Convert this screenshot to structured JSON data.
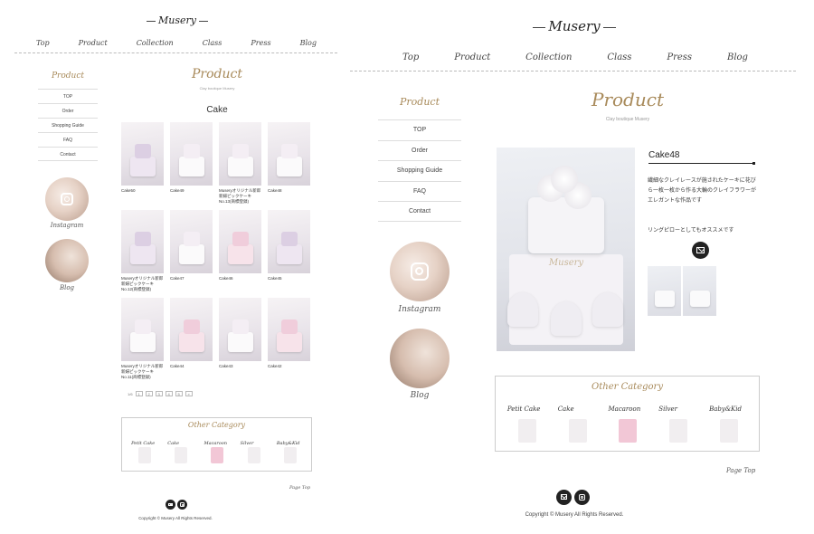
{
  "brand": {
    "logo": "Musery",
    "subtitle": "Clay boutique Musery"
  },
  "nav": [
    "Top",
    "Product",
    "Collection",
    "Class",
    "Press",
    "Blog"
  ],
  "sidebar": {
    "title": "Product",
    "items": [
      "TOP",
      "Order",
      "Shopping Guide",
      "FAQ",
      "Contact"
    ],
    "instagram_label": "Instagram",
    "blog_label": "Blog"
  },
  "list_page": {
    "title": "Product",
    "category": "Cake",
    "products": [
      "Cake50",
      "Cake49",
      "Museryオリジナル新郎新婦ピックケーキNo.13(商標登録)",
      "Cake48",
      "Museryオリジナル新郎新婦ピックケーキNo.12(商標登録)",
      "Cake47",
      "Cake46",
      "Cake45",
      "Museryオリジナル新郎新婦ピックケーキNo.11(商標登録)",
      "Cake44",
      "Cake43",
      "Cake42"
    ],
    "pager": {
      "info": "1/6",
      "pages": [
        "1",
        "2",
        "3",
        "4",
        "5",
        "»"
      ]
    }
  },
  "detail_page": {
    "title": "Product",
    "product_name": "Cake48",
    "description": "繊細なクレイレースが施されたケーキに花びら一枚一枚から作る大輪のクレイフラワーがエレガントな作品です",
    "description2": "リングピローとしてもオススメです",
    "hero_brand": "Musery"
  },
  "other_category": {
    "title": "Other Category",
    "items": [
      "Petit Cake",
      "Cake",
      "Macaroon",
      "Silver",
      "Baby&Kid"
    ]
  },
  "footer": {
    "page_top": "Page Top",
    "copyright": "Copyright © Musery All Rights Reserved."
  },
  "icons": [
    "instagram-icon",
    "mail-icon"
  ],
  "colors": {
    "accent": "#a88a5a",
    "text": "#333333",
    "border": "#cccccc"
  }
}
